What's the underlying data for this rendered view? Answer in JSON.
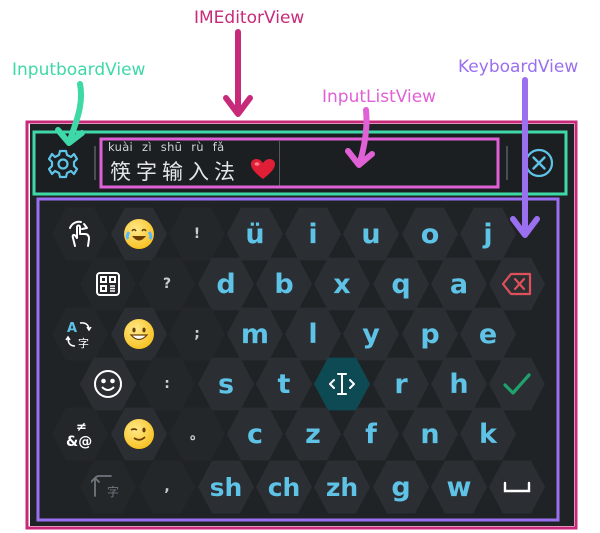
{
  "labels": {
    "imeditor": "IMEditorView",
    "inputboard": "InputboardView",
    "inputlist": "InputListView",
    "keyboard": "KeyboardView"
  },
  "colors": {
    "imeditor": "#c82a7a",
    "inputboard": "#3fd9a8",
    "inputlist": "#e060d6",
    "keyboard": "#9a6ff0",
    "key_letter": "#5ec3e6",
    "confirm": "#1fa36a",
    "delete": "#e0505a"
  },
  "input": {
    "pinyin": "kuài zì shū rù fǎ",
    "hanzi": "筷字输入法"
  },
  "keys": {
    "r1": [
      "ü",
      "i",
      "u",
      "o",
      "j"
    ],
    "r2": [
      "d",
      "b",
      "x",
      "q",
      "a"
    ],
    "r3": [
      "m",
      "l",
      "y",
      "p",
      "e"
    ],
    "r4": [
      "s",
      "t",
      "r",
      "h"
    ],
    "r5": [
      "c",
      "z",
      "f",
      "n",
      "k"
    ],
    "r6": [
      "sh",
      "ch",
      "zh",
      "g",
      "w"
    ],
    "punct": [
      "!",
      "?",
      ";",
      ":",
      "。",
      ","
    ],
    "switch_label": "字",
    "translate_label": "字",
    "symbol_label": "&@"
  }
}
